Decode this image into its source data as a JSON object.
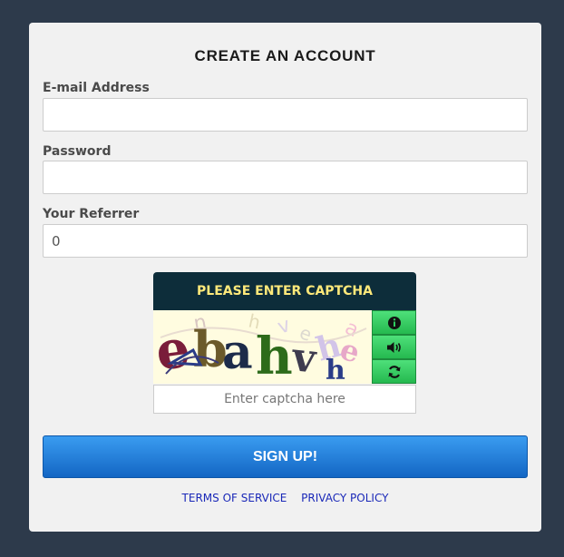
{
  "form": {
    "title": "CREATE AN ACCOUNT",
    "email_label": "E-mail Address",
    "email_value": "",
    "password_label": "Password",
    "password_value": "",
    "referrer_label": "Your Referrer",
    "referrer_value": "0"
  },
  "captcha": {
    "header": "PLEASE ENTER CAPTCHA",
    "input_placeholder": "Enter captcha here",
    "image_text": "ebahvhe",
    "buttons": [
      {
        "name": "info",
        "icon": "info-icon"
      },
      {
        "name": "audio",
        "icon": "speaker-icon"
      },
      {
        "name": "refresh",
        "icon": "refresh-icon"
      }
    ]
  },
  "signup_label": "SIGN UP!",
  "links": {
    "terms": "TERMS OF SERVICE",
    "privacy": "PRIVACY POLICY"
  },
  "colors": {
    "background": "#2d3a4b",
    "card": "#f1f1f1",
    "captcha_header_bg": "#0d2d3a",
    "captcha_header_text": "#ffe97a",
    "captcha_button": "#2ecc5e",
    "signup_button": "#1a78dc",
    "link": "#1a28b8"
  }
}
